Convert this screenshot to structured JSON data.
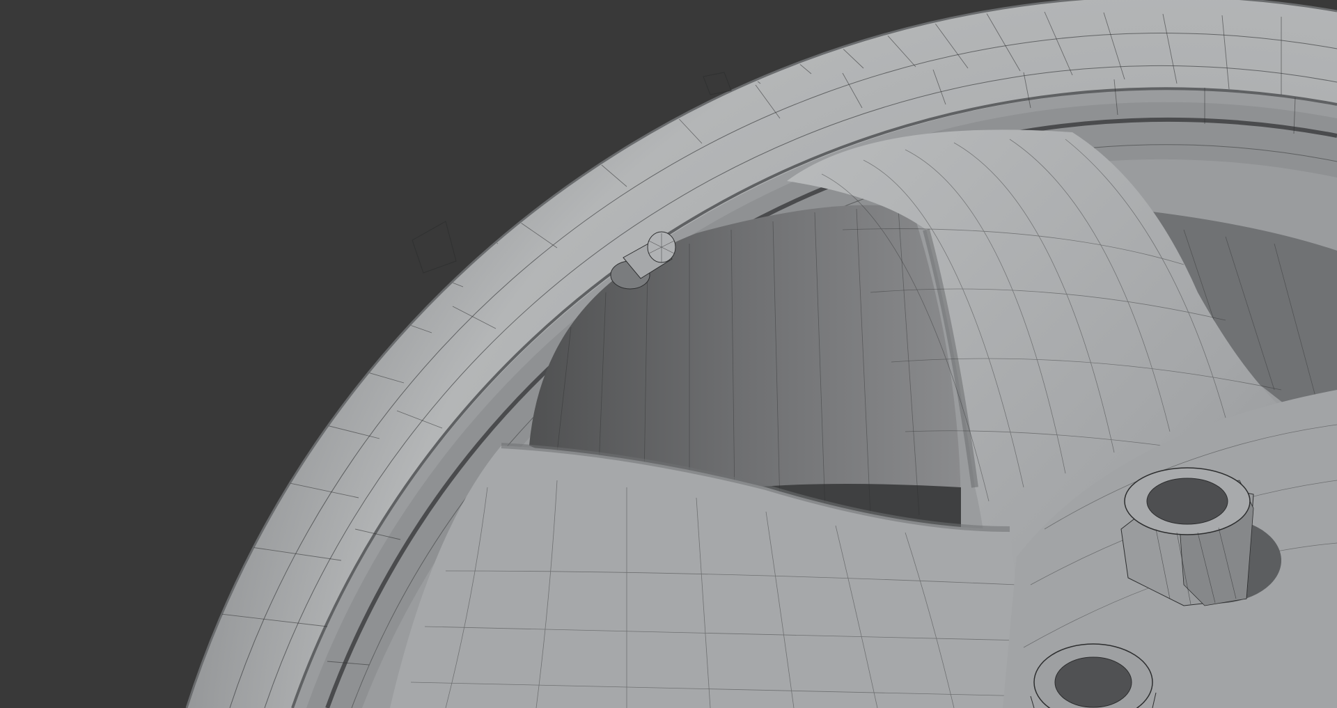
{
  "viewport": {
    "background_color": "#393939",
    "subject": "wheel-rim-wireframe-render",
    "shading": "solid-gray-with-wireframe-overlay"
  },
  "colors": {
    "metal_light": "#b8babb",
    "metal_mid": "#9c9ea0",
    "metal_dark": "#6e7072",
    "interior_shadow": "#4f5051",
    "wire": "#2c2d2e"
  }
}
